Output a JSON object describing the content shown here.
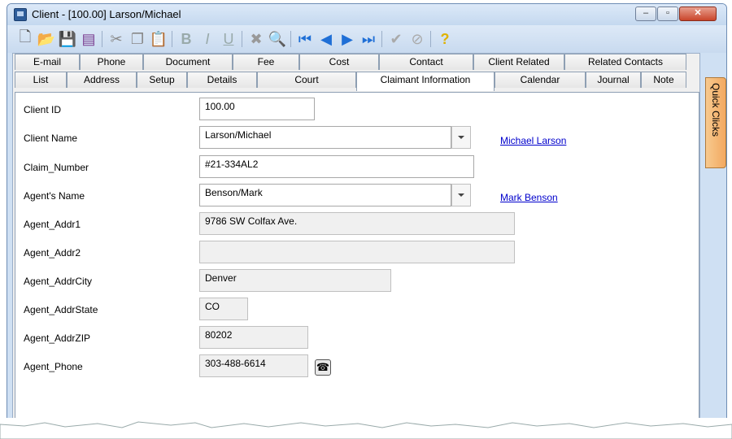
{
  "window": {
    "title": "Client - [100.00] Larson/Michael"
  },
  "tabs_row1": [
    "E-mail",
    "Phone",
    "Document",
    "Fee",
    "Cost",
    "Contact",
    "Client Related",
    "Related Contacts"
  ],
  "tabs_row2": [
    "List",
    "Address",
    "Setup",
    "Details",
    "Court",
    "Claimant Information",
    "Calendar",
    "Journal",
    "Note"
  ],
  "active_tab": "Claimant Information",
  "quick_clicks": "Quick Clicks",
  "form": {
    "client_id": {
      "label": "Client ID",
      "value": "100.00"
    },
    "client_name": {
      "label": "Client Name",
      "value": "Larson/Michael",
      "link": "Michael Larson"
    },
    "claim_number": {
      "label": "Claim_Number",
      "value": "#21-334AL2"
    },
    "agent_name": {
      "label": "Agent's Name",
      "value": "Benson/Mark",
      "link": "Mark Benson"
    },
    "agent_addr1": {
      "label": "Agent_Addr1",
      "value": "9786 SW Colfax Ave."
    },
    "agent_addr2": {
      "label": "Agent_Addr2",
      "value": ""
    },
    "agent_addrcity": {
      "label": "Agent_AddrCity",
      "value": "Denver"
    },
    "agent_addrstate": {
      "label": "Agent_AddrState",
      "value": "CO"
    },
    "agent_addrzip": {
      "label": "Agent_AddrZIP",
      "value": "80202"
    },
    "agent_phone": {
      "label": "Agent_Phone",
      "value": "303-488-6614"
    }
  },
  "icons": {
    "toolbar": [
      "new-icon",
      "open-icon",
      "save-icon",
      "save-close-icon",
      "cut-icon",
      "copy-icon",
      "paste-icon",
      "bold-icon",
      "italic-icon",
      "underline-icon",
      "delete-icon",
      "find-icon",
      "first-record-icon",
      "previous-record-icon",
      "next-record-icon",
      "last-record-icon",
      "check-icon",
      "cancel-icon",
      "help-icon"
    ],
    "phone": "telephone-icon"
  }
}
